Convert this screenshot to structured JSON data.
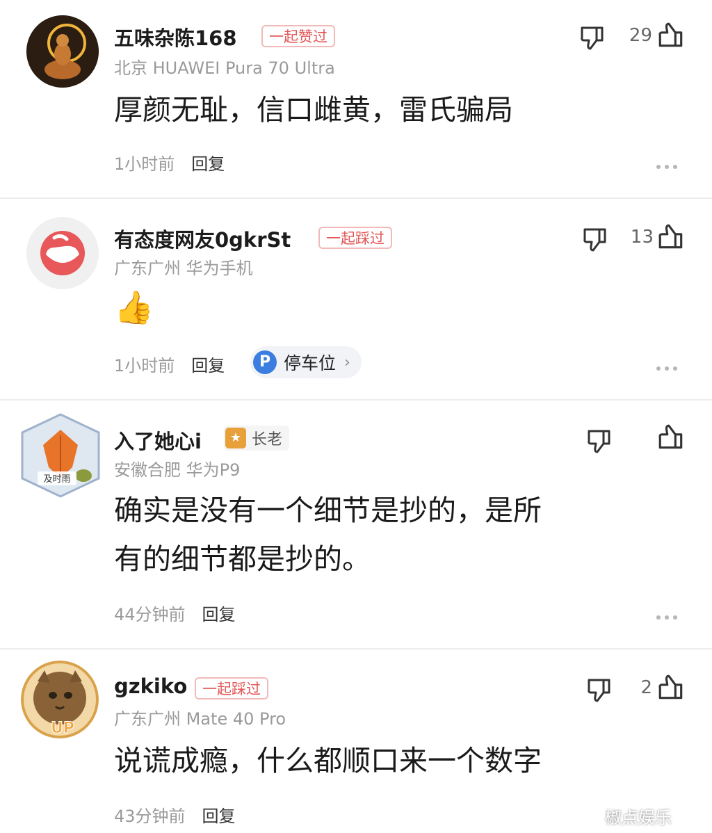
{
  "comments": [
    {
      "username": "五味杂陈168",
      "badge": "一起赞过",
      "meta": "北京  HUAWEI Pura 70 Ultra",
      "text": "厚颜无耻，信口雌黄，雷氏骗局",
      "time": "1小时前",
      "reply": "回复",
      "likes": "29"
    },
    {
      "username": "有态度网友0gkrSt",
      "badge": "一起踩过",
      "meta": "广东广州  华为手机",
      "emoji": "👍",
      "time": "1小时前",
      "reply": "回复",
      "chip_icon": "P",
      "chip_label": "停车位",
      "likes": "13"
    },
    {
      "username": "入了她心i",
      "badge": "长老",
      "badge_icon": "★",
      "meta": "安徽合肥  华为P9",
      "text_line1": "确实是没有一个细节是抄的，是所",
      "text_line2": "有的细节都是抄的。",
      "avatar_text": "及时雨",
      "time": "44分钟前",
      "reply": "回复",
      "likes": ""
    },
    {
      "username": "gzkiko",
      "badge": "一起踩过",
      "meta": "广东广州  Mate 40 Pro",
      "text": "说谎成瘾，什么都顺口来一个数字",
      "avatar_text": "UP",
      "time": "43分钟前",
      "reply": "回复",
      "likes": "2"
    }
  ],
  "icons": {
    "like": "thumbs-up-icon",
    "dislike": "thumbs-down-icon",
    "more": "more-dots-icon"
  },
  "watermark": "椒点娱乐",
  "colors": {
    "badge_red": "#e35757",
    "chip_blue": "#3b7de0",
    "elder_orange": "#e8a03a"
  }
}
